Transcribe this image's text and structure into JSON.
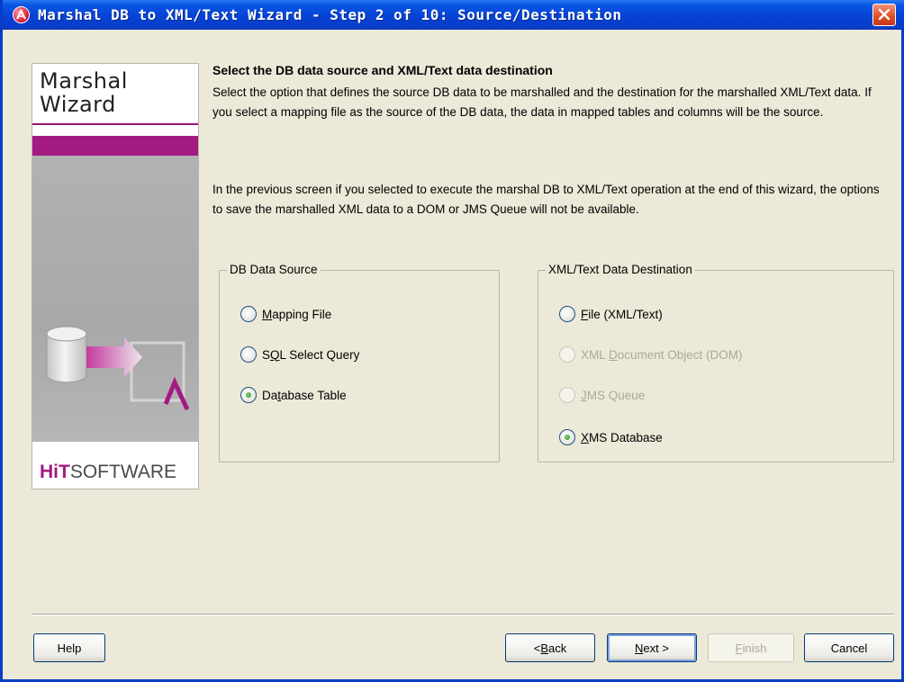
{
  "window": {
    "title": "Marshal DB to XML/Text Wizard - Step 2 of 10: Source/Destination"
  },
  "banner": {
    "title": "Marshal\nWizard",
    "logo_bold": "HiT",
    "logo_rest": "SOFTWARE"
  },
  "content": {
    "heading": "Select the DB data source and XML/Text data destination",
    "paragraph1": "Select the option that defines the source DB data to be marshalled and the destination for the marshalled XML/Text data. If you select a mapping file as the source of the DB data, the data in mapped tables and columns will be the source.",
    "paragraph2": "In the previous screen if you selected to execute the marshal DB to XML/Text operation at the end of this wizard, the options to save the marshalled XML data to a DOM or JMS Queue will not be available."
  },
  "db_source": {
    "legend": "DB Data Source",
    "options": [
      {
        "pre": "",
        "mnemonic": "M",
        "post": "apping File",
        "checked": false,
        "enabled": true
      },
      {
        "pre": "S",
        "mnemonic": "Q",
        "post": "L Select Query",
        "checked": false,
        "enabled": true
      },
      {
        "pre": "Da",
        "mnemonic": "t",
        "post": "abase Table",
        "checked": true,
        "enabled": true
      }
    ]
  },
  "xml_destination": {
    "legend": "XML/Text Data Destination",
    "options": [
      {
        "pre": "",
        "mnemonic": "F",
        "post": "ile (XML/Text)",
        "checked": false,
        "enabled": true
      },
      {
        "pre": "XML ",
        "mnemonic": "D",
        "post": "ocument Object (DOM)",
        "checked": false,
        "enabled": false
      },
      {
        "pre": "",
        "mnemonic": "J",
        "post": "MS Queue",
        "checked": false,
        "enabled": false
      },
      {
        "pre": "",
        "mnemonic": "X",
        "post": "MS Database",
        "checked": true,
        "enabled": true
      }
    ]
  },
  "buttons": {
    "help": "Help",
    "back_pre": "< ",
    "back_mn": "B",
    "back_post": "ack",
    "next_pre": "",
    "next_mn": "N",
    "next_post": "ext >",
    "finish_pre": "",
    "finish_mn": "F",
    "finish_post": "inish",
    "cancel": "Cancel"
  },
  "colors": {
    "titlebar": "#0a3cc8",
    "brand_purple": "#a31a83",
    "radio_checked": "#219119"
  }
}
